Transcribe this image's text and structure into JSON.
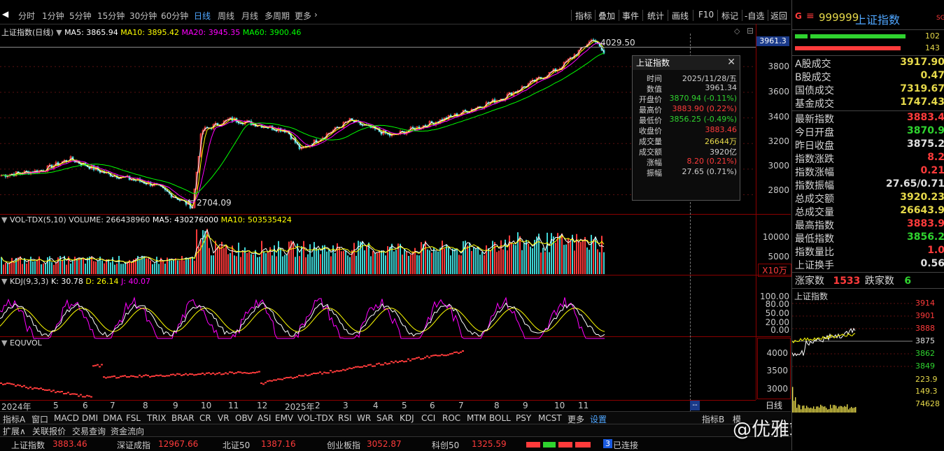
{
  "toolbar": {
    "periods": [
      "分时",
      "1分钟",
      "5分钟",
      "15分钟",
      "30分钟",
      "60分钟",
      "日线",
      "周线",
      "月线",
      "多周期",
      "更多"
    ],
    "active_period": "日线",
    "right_buttons": [
      "指标",
      "叠加",
      "事件",
      "统计",
      "画线",
      "F10",
      "标记",
      "-自选",
      "返回"
    ]
  },
  "main_legend": {
    "title": "上证指数(日线)",
    "ma5": "MA5: 3865.94",
    "ma10": "MA10: 3895.42",
    "ma20": "MA20: 3945.35",
    "ma60": "MA60: 3900.46"
  },
  "main_chart": {
    "y_ticks": [
      "3800",
      "3600",
      "3400",
      "3200",
      "3000",
      "2800"
    ],
    "high_label": "4029.50",
    "low_label": "2704.09",
    "crosshair_value": "3961.3"
  },
  "tooltip": {
    "title": "上证指数",
    "rows": [
      {
        "k": "时间",
        "v": "2025/11/28/五",
        "color": "#d0d0d0"
      },
      {
        "k": "数值",
        "v": "3961.34",
        "color": "#d0d0d0"
      },
      {
        "k": "开盘价",
        "v": "3870.94 (-0.11%)",
        "color": "#2fd32f"
      },
      {
        "k": "最高价",
        "v": "3883.90 (0.22%)",
        "color": "#ff3b3b"
      },
      {
        "k": "最低价",
        "v": "3856.25 (-0.49%)",
        "color": "#2fd32f"
      },
      {
        "k": "收盘价",
        "v": "3883.46",
        "color": "#ff3b3b"
      },
      {
        "k": "成交量",
        "v": "26644万",
        "color": "#e6d94a"
      },
      {
        "k": "成交额",
        "v": "3920亿",
        "color": "#d0d0d0"
      },
      {
        "k": "涨幅",
        "v": "8.20 (0.21%)",
        "color": "#ff3b3b"
      },
      {
        "k": "振幅",
        "v": "27.65 (0.71%)",
        "color": "#d0d0d0"
      }
    ]
  },
  "vol_legend": {
    "title": "VOL-TDX(5,10)",
    "volume": "VOLUME: 266438960",
    "ma5": "MA5: 430276000",
    "ma10": "MA10: 503535424",
    "y_ticks": [
      "10000",
      "5000"
    ],
    "unit": "X10万"
  },
  "kdj_legend": {
    "title": "KDJ(9,3,3)",
    "k": "K: 30.78",
    "d": "D: 26.14",
    "j": "J: 40.07",
    "y_ticks": [
      "100.00",
      "80.00",
      "50.00",
      "20.00",
      "0.00"
    ]
  },
  "equvol_legend": {
    "title": "EQUVOL",
    "y_ticks": [
      "4000",
      "3500",
      "3000"
    ]
  },
  "x_axis": {
    "labels": [
      "2024年",
      "5",
      "6",
      "7",
      "8",
      "9",
      "10",
      "11",
      "12",
      "2025年",
      "2",
      "3",
      "4",
      "5",
      "6",
      "7",
      "8",
      "9",
      "10",
      "11"
    ],
    "period_label": "日线"
  },
  "bottom_tabs": [
    "指标A",
    "窗口",
    "MACD",
    "DMI",
    "DMA",
    "FSL",
    "TRIX",
    "BRAR",
    "CR",
    "VR",
    "OBV",
    "ASI",
    "EMV",
    "VOL-TDX",
    "RSI",
    "WR",
    "SAR",
    "KDJ",
    "CCI",
    "ROC",
    "MTM",
    "BOLL",
    "PSY",
    "MCST",
    "更多",
    "设置"
  ],
  "bottom_right_tabs": [
    "指标B",
    "模"
  ],
  "row2_tabs": [
    "扩展∧",
    "关联报价",
    "交易查询",
    "资金流向"
  ],
  "statusbar": [
    {
      "name": "上证指数",
      "value": "3883.46"
    },
    {
      "name": "深证成指",
      "value": "12967.66"
    },
    {
      "name": "北证50",
      "value": "1387.16"
    },
    {
      "name": "创业板指",
      "value": "3052.87"
    },
    {
      "name": "科创50",
      "value": "1325.59"
    }
  ],
  "status_connected": "已连接",
  "watermark": "@优雅端庄晚风",
  "right_panel": {
    "code": "999999",
    "name": "上证指数",
    "flag": "SG",
    "bar_values": [
      "102",
      "143"
    ],
    "rows": [
      {
        "k": "A股成交",
        "v": "3917.90",
        "color": "#e6d94a"
      },
      {
        "k": "B股成交",
        "v": "0.47",
        "color": "#e6d94a"
      },
      {
        "k": "国债成交",
        "v": "7319.67",
        "color": "#e6d94a"
      },
      {
        "k": "基金成交",
        "v": "1747.43",
        "color": "#e6d94a"
      },
      {
        "k": "最新指数",
        "v": "3883.4",
        "color": "#ff3b3b"
      },
      {
        "k": "今日开盘",
        "v": "3870.9",
        "color": "#2fd32f"
      },
      {
        "k": "昨日收盘",
        "v": "3875.2",
        "color": "#e0e0e0"
      },
      {
        "k": "指数涨跌",
        "v": "8.2",
        "color": "#ff3b3b"
      },
      {
        "k": "指数涨幅",
        "v": "0.21",
        "color": "#ff3b3b"
      },
      {
        "k": "指数振幅",
        "v": "27.65/0.71",
        "color": "#e0e0e0"
      },
      {
        "k": "总成交额",
        "v": "3920.23",
        "color": "#e6d94a"
      },
      {
        "k": "总成交量",
        "v": "26643.9",
        "color": "#e6d94a"
      },
      {
        "k": "最高指数",
        "v": "3883.9",
        "color": "#ff3b3b"
      },
      {
        "k": "最低指数",
        "v": "3856.2",
        "color": "#2fd32f"
      },
      {
        "k": "指数量比",
        "v": "1.0",
        "color": "#ff3b3b"
      },
      {
        "k": "上证换手",
        "v": "0.56",
        "color": "#e0e0e0"
      }
    ],
    "breadth": {
      "up_label": "涨家数",
      "up": "1533",
      "down_label": "跌家数",
      "down": "6"
    },
    "mini_title": "上证指数",
    "mini_ticks": [
      "3914",
      "3901",
      "3888",
      "3875",
      "3862",
      "3849"
    ],
    "mini_vol_ticks": [
      "223.9",
      "149.3",
      "74628"
    ]
  },
  "colors": {
    "up": "#ff3b3b",
    "down": "#2fd32f",
    "ma5": "#ffffff",
    "ma10": "#ffff00",
    "ma20": "#ff00ff",
    "ma60": "#00ff00"
  }
}
